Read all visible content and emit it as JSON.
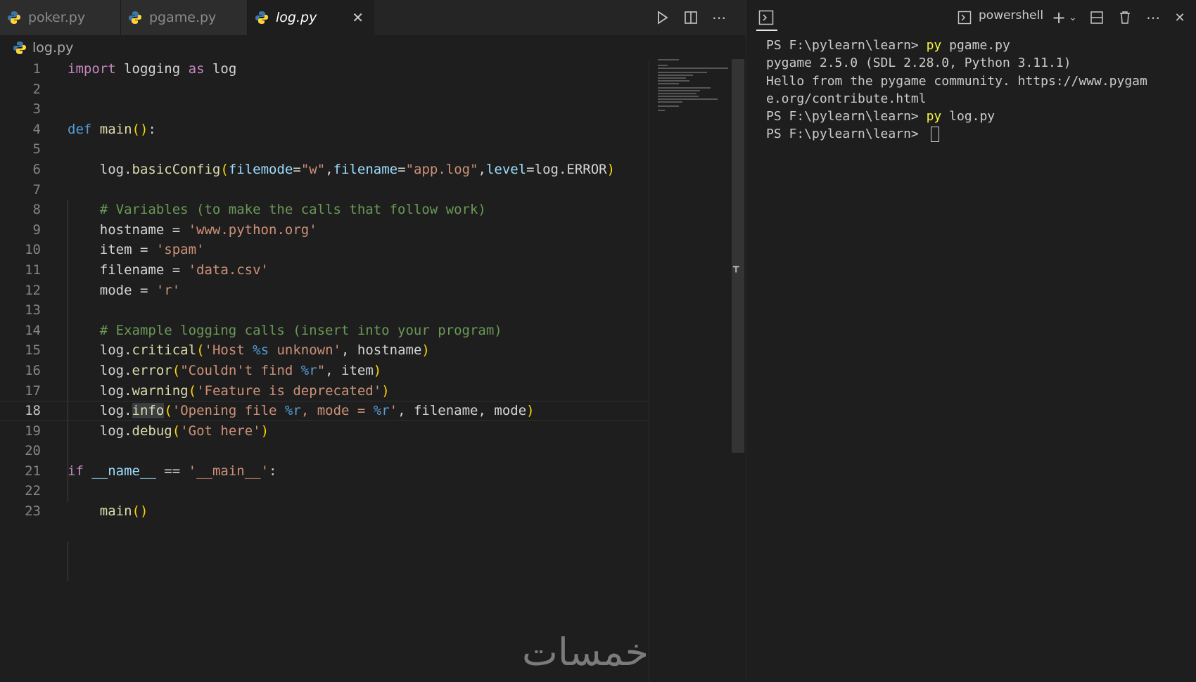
{
  "tabs": [
    {
      "label": "poker.py",
      "active": false
    },
    {
      "label": "pgame.py",
      "active": false
    },
    {
      "label": "log.py",
      "active": true
    }
  ],
  "breadcrumb": "log.py",
  "editor_actions": [
    "run-icon",
    "split-editor-icon",
    "more-icon"
  ],
  "code": {
    "line_numbers": [
      "1",
      "2",
      "3",
      "4",
      "5",
      "6",
      "7",
      "8",
      "9",
      "10",
      "11",
      "12",
      "13",
      "14",
      "15",
      "16",
      "17",
      "18",
      "19",
      "20",
      "21",
      "22",
      "23"
    ],
    "active_line": "18",
    "l1": {
      "import": "import",
      "mod": "logging",
      "as": "as",
      "alias": "log"
    },
    "l4": {
      "def": "def",
      "name": "main",
      "open": "(",
      "close": ")",
      "colon": ":"
    },
    "l6": {
      "obj": "log",
      "dot": ".",
      "fn": "basicConfig",
      "open": "(",
      "k1": "filemode",
      "eq1": "=",
      "v1": "\"w\"",
      "c1": ",",
      "k2": "filename",
      "eq2": "=",
      "v2": "\"app.log\"",
      "c2": ",",
      "k3": "level",
      "eq3": "=",
      "v3": "log.ERROR",
      "close": ")"
    },
    "l8": "# Variables (to make the calls that follow work)",
    "l9": {
      "var": "hostname",
      "eq": " = ",
      "val": "'www.python.org'"
    },
    "l10": {
      "var": "item",
      "eq": " = ",
      "val": "'spam'"
    },
    "l11": {
      "var": "filename",
      "eq": " = ",
      "val": "'data.csv'"
    },
    "l12": {
      "var": "mode",
      "eq": " = ",
      "val": "'r'"
    },
    "l14": "# Example logging calls (insert into your program)",
    "l15": {
      "obj": "log",
      "dot": ".",
      "fn": "critical",
      "open": "(",
      "s1": "'Host ",
      "fmt": "%s",
      "s2": " unknown'",
      "rest": ", hostname",
      "close": ")"
    },
    "l16": {
      "obj": "log",
      "dot": ".",
      "fn": "error",
      "open": "(",
      "s1": "\"Couldn't find ",
      "fmt": "%r",
      "s2": "\"",
      "rest": ", item",
      "close": ")"
    },
    "l17": {
      "obj": "log",
      "dot": ".",
      "fn": "warning",
      "open": "(",
      "s1": "'Feature is deprecated'",
      "close": ")"
    },
    "l18": {
      "obj": "log",
      "dot": ".",
      "fn": "info",
      "open": "(",
      "s1": "'Opening file ",
      "fmt1": "%r",
      "s2": ", mode = ",
      "fmt2": "%r",
      "s3": "'",
      "rest": ", filename, mode",
      "close": ")"
    },
    "l19": {
      "obj": "log",
      "dot": ".",
      "fn": "debug",
      "open": "(",
      "s1": "'Got here'",
      "close": ")"
    },
    "l21": {
      "if": "if",
      "name": "__name__",
      "eq": " == ",
      "val": "'__main__'",
      "colon": ":"
    },
    "l23": {
      "fn": "main",
      "open": "(",
      "close": ")"
    }
  },
  "terminal": {
    "shell": "powershell",
    "lines": [
      {
        "prompt": "PS F:\\pylearn\\learn> ",
        "cmd": "py",
        "args": " pgame.py"
      },
      {
        "text": "pygame 2.5.0 (SDL 2.28.0, Python 3.11.1)"
      },
      {
        "text": "Hello from the pygame community. https://www.pygam"
      },
      {
        "text": "e.org/contribute.html"
      },
      {
        "prompt": "PS F:\\pylearn\\learn> ",
        "cmd": "py",
        "args": " log.py"
      },
      {
        "prompt": "PS F:\\pylearn\\learn> "
      }
    ]
  },
  "watermark": "خمسات"
}
